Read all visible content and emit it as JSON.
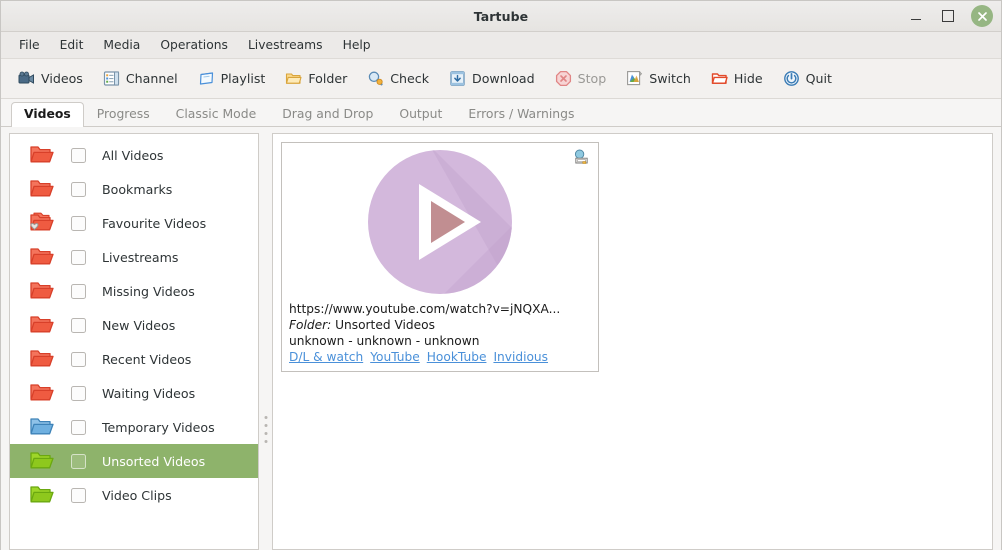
{
  "window": {
    "title": "Tartube",
    "controls": {
      "minimize": "minimize-button",
      "maximize": "maximize-button",
      "close": "close-button"
    },
    "close_color": "#96b683"
  },
  "menubar": {
    "items": [
      {
        "label": "File"
      },
      {
        "label": "Edit"
      },
      {
        "label": "Media"
      },
      {
        "label": "Operations"
      },
      {
        "label": "Livestreams"
      },
      {
        "label": "Help"
      }
    ]
  },
  "toolbar": {
    "buttons": [
      {
        "label": "Videos",
        "icon": "videos-camera-icon",
        "disabled": false
      },
      {
        "label": "Channel",
        "icon": "channel-list-icon",
        "disabled": false
      },
      {
        "label": "Playlist",
        "icon": "playlist-icon",
        "disabled": false
      },
      {
        "label": "Folder",
        "icon": "folder-icon",
        "disabled": false
      },
      {
        "label": "Check",
        "icon": "check-magnifier-icon",
        "disabled": false
      },
      {
        "label": "Download",
        "icon": "download-icon",
        "disabled": false
      },
      {
        "label": "Stop",
        "icon": "stop-icon",
        "disabled": true
      },
      {
        "label": "Switch",
        "icon": "switch-icon",
        "disabled": false
      },
      {
        "label": "Hide",
        "icon": "hide-folder-icon",
        "disabled": false
      },
      {
        "label": "Quit",
        "icon": "quit-power-icon",
        "disabled": false
      }
    ]
  },
  "tabs": {
    "items": [
      {
        "label": "Videos",
        "active": true
      },
      {
        "label": "Progress",
        "active": false
      },
      {
        "label": "Classic Mode",
        "active": false
      },
      {
        "label": "Drag and Drop",
        "active": false
      },
      {
        "label": "Output",
        "active": false
      },
      {
        "label": "Errors / Warnings",
        "active": false
      }
    ]
  },
  "sidebar": {
    "items": [
      {
        "label": "All Videos",
        "icon": "folder-red-icon",
        "color": "red",
        "selected": false,
        "checked": false,
        "badge": ""
      },
      {
        "label": "Bookmarks",
        "icon": "folder-red-icon",
        "color": "red",
        "selected": false,
        "checked": false,
        "badge": ""
      },
      {
        "label": "Favourite Videos",
        "icon": "folder-red-heart-icon",
        "color": "red",
        "selected": false,
        "checked": false,
        "badge": "heart"
      },
      {
        "label": "Livestreams",
        "icon": "folder-red-icon",
        "color": "red",
        "selected": false,
        "checked": false,
        "badge": ""
      },
      {
        "label": "Missing Videos",
        "icon": "folder-red-icon",
        "color": "red",
        "selected": false,
        "checked": false,
        "badge": ""
      },
      {
        "label": "New Videos",
        "icon": "folder-red-icon",
        "color": "red",
        "selected": false,
        "checked": false,
        "badge": ""
      },
      {
        "label": "Recent Videos",
        "icon": "folder-red-icon",
        "color": "red",
        "selected": false,
        "checked": false,
        "badge": ""
      },
      {
        "label": "Waiting Videos",
        "icon": "folder-red-icon",
        "color": "red",
        "selected": false,
        "checked": false,
        "badge": ""
      },
      {
        "label": "Temporary Videos",
        "icon": "folder-blue-icon",
        "color": "blue",
        "selected": false,
        "checked": false,
        "badge": ""
      },
      {
        "label": "Unsorted Videos",
        "icon": "folder-green-icon",
        "color": "green",
        "selected": true,
        "checked": false,
        "badge": ""
      },
      {
        "label": "Video Clips",
        "icon": "folder-green-icon",
        "color": "green",
        "selected": false,
        "checked": false,
        "badge": ""
      }
    ],
    "selection_color": "#8eb36b"
  },
  "main": {
    "video_cards": [
      {
        "url": "https://www.youtube.com/watch?v=jNQXA...",
        "folder_label": "Folder:",
        "folder_value": "Unsorted Videos",
        "meta": "unknown  -  unknown  -  unknown",
        "thumbnail_color": "#d3b8dc",
        "thumbnail_icon": "play-button-icon",
        "badge_icon": "image-thumbnail-icon",
        "links": [
          {
            "label": "D/L & watch"
          },
          {
            "label": "YouTube"
          },
          {
            "label": "HookTube"
          },
          {
            "label": "Invidious"
          }
        ],
        "link_color": "#4a90d9"
      }
    ]
  }
}
